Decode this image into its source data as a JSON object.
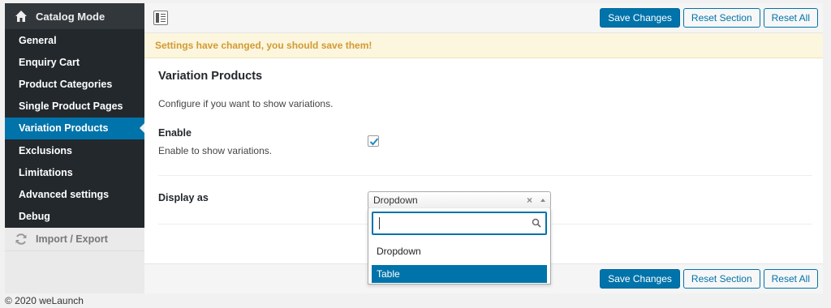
{
  "sidebar": {
    "title": "Catalog Mode",
    "items": [
      {
        "label": "General"
      },
      {
        "label": "Enquiry Cart"
      },
      {
        "label": "Product Categories"
      },
      {
        "label": "Single Product Pages"
      },
      {
        "label": "Variation Products",
        "active": true
      },
      {
        "label": "Exclusions"
      },
      {
        "label": "Limitations"
      },
      {
        "label": "Advanced settings"
      },
      {
        "label": "Debug"
      }
    ],
    "import_export": "Import / Export"
  },
  "toolbar": {
    "save_label": "Save Changes",
    "reset_section_label": "Reset Section",
    "reset_all_label": "Reset All"
  },
  "notice": "Settings have changed, you should save them!",
  "section": {
    "title": "Variation Products",
    "description": "Configure if you want to show variations."
  },
  "fields": {
    "enable": {
      "label": "Enable",
      "description": "Enable to show variations.",
      "checked": true
    },
    "display_as": {
      "label": "Display as",
      "value": "Dropdown",
      "clear": "×",
      "search_value": "",
      "options": [
        "Dropdown",
        "Table"
      ],
      "highlighted": "Table"
    }
  },
  "footer": "© 2020 weLaunch",
  "colors": {
    "accent": "#0073aa",
    "sidebar_bg": "#23282d",
    "notice_text": "#d39a35"
  }
}
